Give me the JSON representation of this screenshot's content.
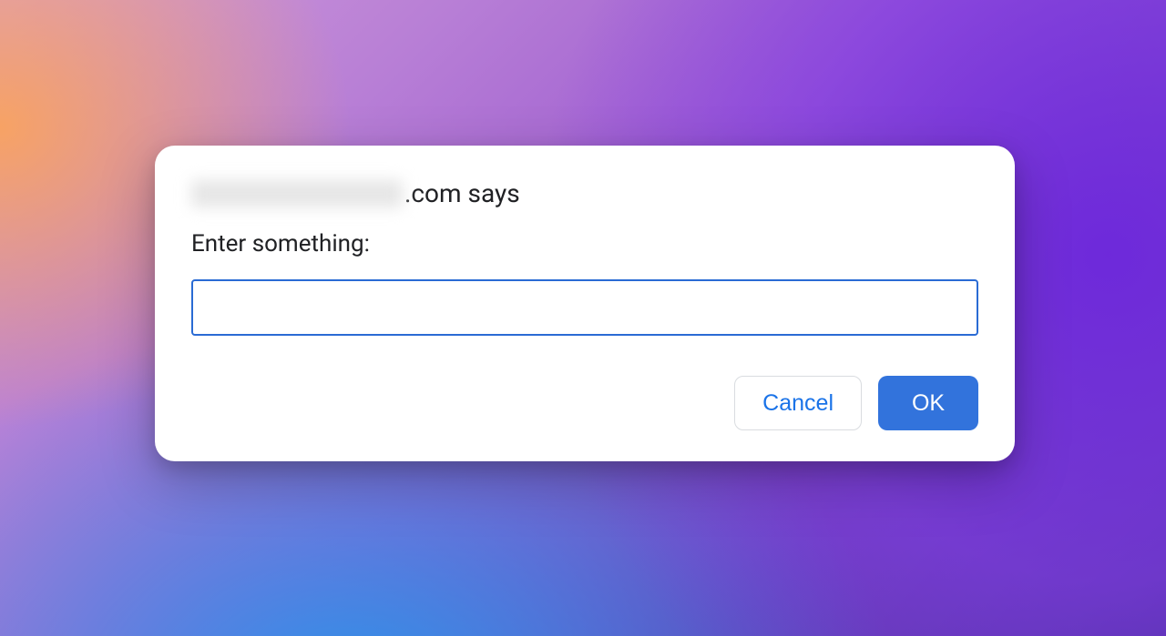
{
  "dialog": {
    "domain_suffix": ".com says",
    "message": "Enter something:",
    "input_value": "",
    "input_placeholder": "",
    "cancel_label": "Cancel",
    "ok_label": "OK"
  }
}
